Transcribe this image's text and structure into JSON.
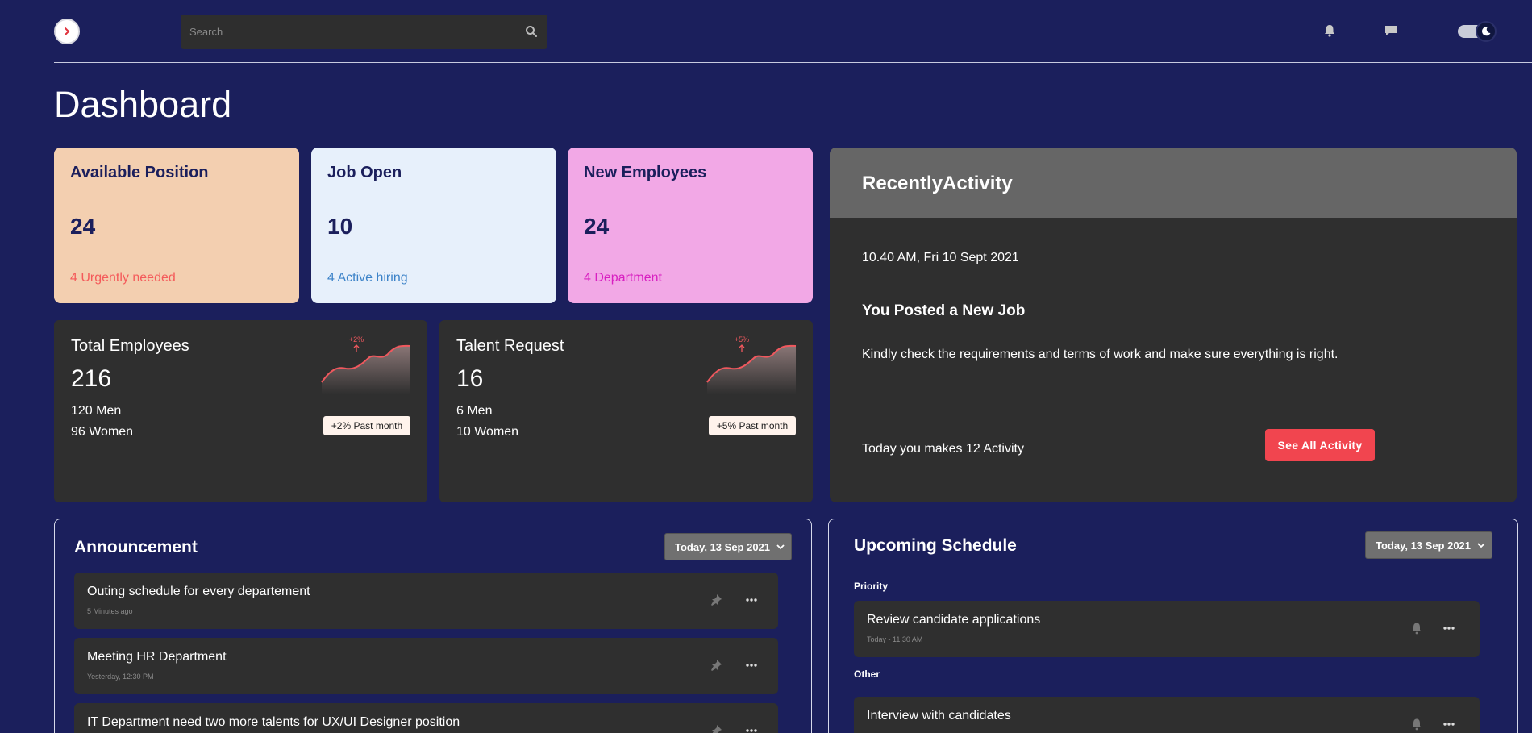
{
  "topbar": {
    "search_placeholder": "Search",
    "icons": [
      "chevron-right-icon",
      "search-icon",
      "bell-icon",
      "chat-icon",
      "moon-icon"
    ]
  },
  "page_title": "Dashboard",
  "stats": [
    {
      "label": "Available Position",
      "value": "24",
      "sub": "4 Urgently needed",
      "bg": "#f3cfb0",
      "sub_color": "#f45a5a"
    },
    {
      "label": "Job Open",
      "value": "10",
      "sub": "4 Active hiring",
      "bg": "#e7f0fb",
      "sub_color": "#3b82c8"
    },
    {
      "label": "New Employees",
      "value": "24",
      "sub": "4 Department",
      "bg": "#f2a8e6",
      "sub_color": "#d81fc1"
    }
  ],
  "employees": {
    "title": "Total Employees",
    "value": "216",
    "men": "120 Men",
    "women": "96 Women",
    "change": "+2%",
    "badge": "+2% Past month"
  },
  "talent": {
    "title": "Talent Request",
    "value": "16",
    "men": "6 Men",
    "women": "10 Women",
    "change": "+5%",
    "badge": "+5% Past month"
  },
  "recent": {
    "title": "RecentlyActivity",
    "time": "10.40 AM, Fri 10 Sept 2021",
    "headline": "You Posted a New Job",
    "description": "Kindly check the requirements and terms of work and make sure everything is right.",
    "today": "Today you makes 12 Activity",
    "button": "See All Activity"
  },
  "announcement": {
    "title": "Announcement",
    "date": "Today, 13 Sep 2021",
    "items": [
      {
        "title": "Outing schedule for every departement",
        "time": "5 Minutes ago"
      },
      {
        "title": "Meeting HR Department",
        "time": "Yesterday, 12:30 PM"
      },
      {
        "title": "IT Department need two more talents for UX/UI Designer position",
        "time": ""
      }
    ]
  },
  "schedule": {
    "title": "Upcoming Schedule",
    "date": "Today, 13 Sep 2021",
    "priority_label": "Priority",
    "other_label": "Other",
    "priority_items": [
      {
        "title": "Review candidate applications",
        "time": "Today - 11.30 AM"
      }
    ],
    "other_items": [
      {
        "title": "Interview with candidates",
        "time": ""
      }
    ]
  },
  "colors": {
    "background": "#1b1f5c",
    "card_dark": "#2f2f2f",
    "accent_red": "#f1454f"
  }
}
